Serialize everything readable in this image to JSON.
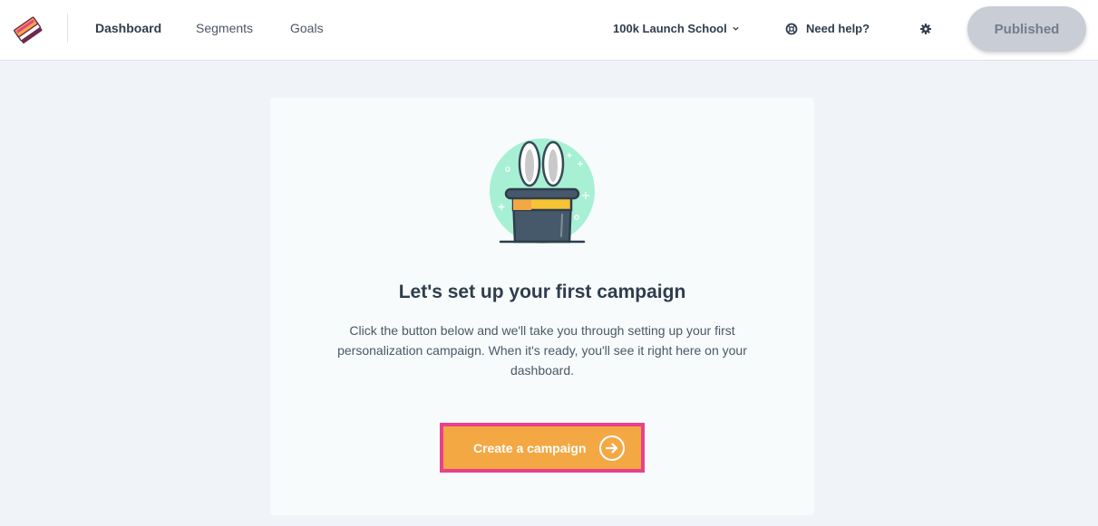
{
  "header": {
    "nav": [
      {
        "label": "Dashboard",
        "active": true
      },
      {
        "label": "Segments",
        "active": false
      },
      {
        "label": "Goals",
        "active": false
      }
    ],
    "workspace": "100k Launch School",
    "help_label": "Need help?",
    "publish_label": "Published",
    "icons": {
      "logo": "stacked-cards-logo-icon",
      "workspace_dropdown": "chevron-down-icon",
      "help": "lifebuoy-icon",
      "settings": "gear-icon"
    }
  },
  "empty_state": {
    "illustration": "rabbit-in-magic-hat-icon",
    "title": "Let's set up your first campaign",
    "description": "Click the button below and we'll take you through setting up your first personalization campaign. When it's ready, you'll see it right here on your dashboard.",
    "cta_label": "Create a campaign",
    "cta_icon": "arrow-right-circle-icon"
  },
  "colors": {
    "page_bg": "#f0f3f8",
    "card_bg": "#f7fbfc",
    "cta": "#f4a844",
    "highlight": "#e9418c",
    "publish_bg": "#c8cdd6"
  }
}
